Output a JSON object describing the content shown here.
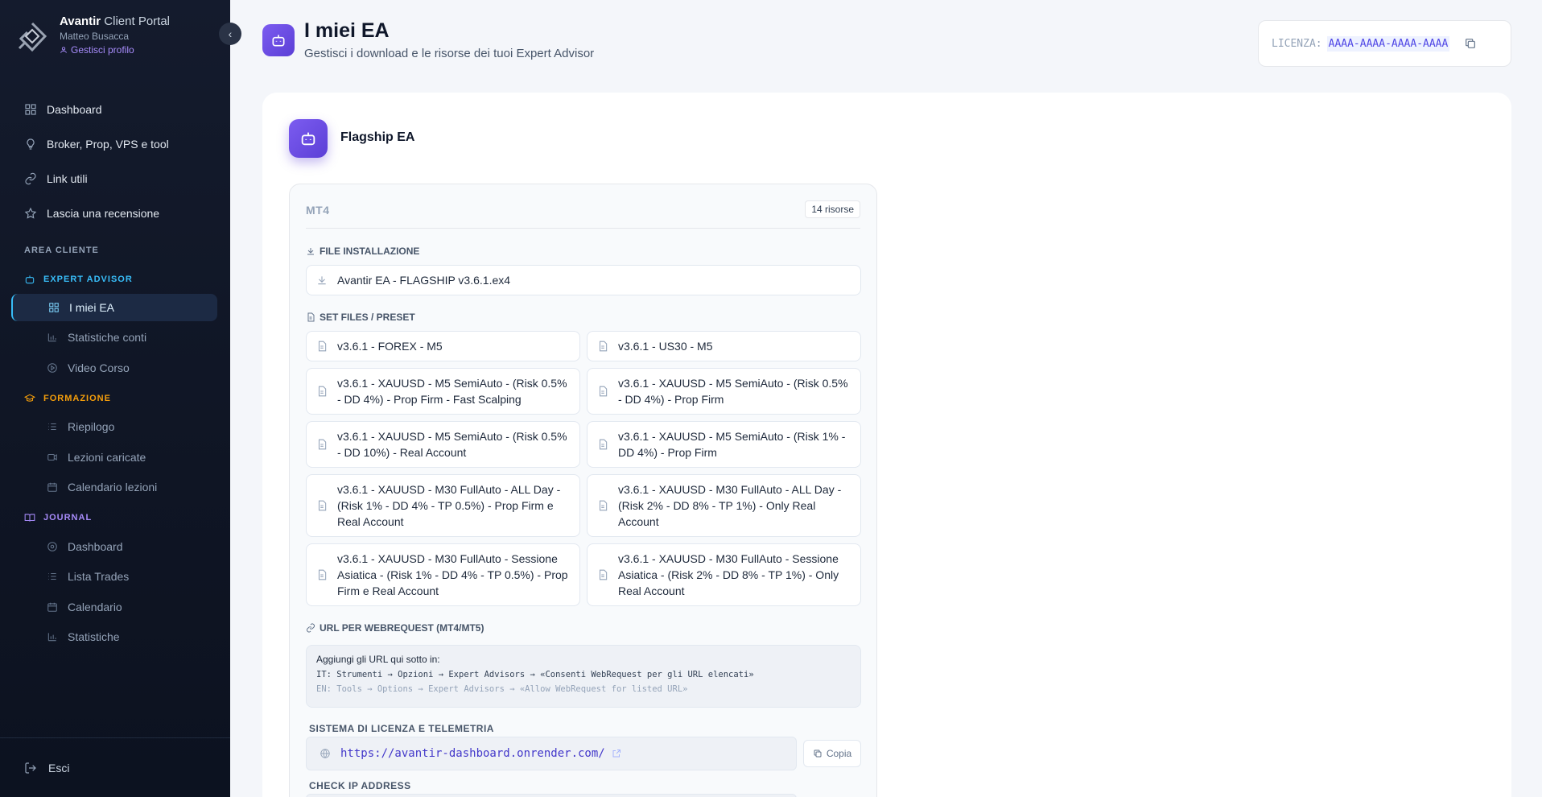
{
  "brand": {
    "name_bold": "Avantir",
    "name_light": "Client Portal",
    "user": "Matteo Busacca",
    "profile_link": "Gestisci profilo"
  },
  "nav": {
    "items": [
      {
        "label": "Dashboard",
        "icon": "grid-icon"
      },
      {
        "label": "Broker, Prop, VPS e tool",
        "icon": "lightbulb-icon"
      },
      {
        "label": "Link utili",
        "icon": "link-icon"
      },
      {
        "label": "Lascia una recensione",
        "icon": "star-icon"
      }
    ]
  },
  "area_cliente": "AREA CLIENTE",
  "groups": {
    "expert_advisor": {
      "label": "EXPERT ADVISOR",
      "color": "#38bdf8",
      "items": [
        "I miei EA",
        "Statistiche conti",
        "Video Corso"
      ]
    },
    "formazione": {
      "label": "FORMAZIONE",
      "color": "#f59e0b",
      "items": [
        "Riepilogo",
        "Lezioni caricate",
        "Calendario lezioni"
      ]
    },
    "journal": {
      "label": "JOURNAL",
      "color": "#a78bfa",
      "items": [
        "Dashboard",
        "Lista Trades",
        "Calendario",
        "Statistiche"
      ]
    }
  },
  "footer": {
    "logout": "Esci"
  },
  "header": {
    "title": "I miei EA",
    "subtitle": "Gestisci i download e le risorse dei tuoi Expert Advisor"
  },
  "license": {
    "label": "LICENZA:",
    "key": "AAAA-AAAA-AAAA-AAAA"
  },
  "ea": {
    "name": "Flagship EA",
    "platform": "MT4",
    "resources_badge": "14 risorse",
    "install_section": "FILE INSTALLAZIONE",
    "install_file": "Avantir EA - FLAGSHIP v3.6.1.ex4",
    "set_section": "SET FILES / PRESET",
    "set_files": [
      "v3.6.1 - FOREX - M5",
      "v3.6.1 - US30 - M5",
      "v3.6.1 - XAUUSD - M5 SemiAuto - (Risk 0.5% - DD 4%) - Prop Firm - Fast Scalping",
      "v3.6.1 - XAUUSD - M5 SemiAuto - (Risk 0.5% - DD 4%) - Prop Firm",
      "v3.6.1 - XAUUSD - M5 SemiAuto - (Risk 0.5% - DD 10%) - Real Account",
      "v3.6.1 - XAUUSD - M5 SemiAuto - (Risk 1% - DD 4%) - Prop Firm",
      "v3.6.1 - XAUUSD - M30 FullAuto - ALL Day - (Risk 1% - DD 4% - TP 0.5%) - Prop Firm e Real Account",
      "v3.6.1 - XAUUSD - M30 FullAuto - ALL Day - (Risk 2% - DD 8% - TP 1%) - Only Real Account",
      "v3.6.1 - XAUUSD - M30 FullAuto - Sessione Asiatica - (Risk 1% - DD 4% - TP 0.5%) - Prop Firm e Real Account",
      "v3.6.1 - XAUUSD - M30 FullAuto - Sessione Asiatica - (Risk 2% - DD 8% - TP 1%) - Only Real Account"
    ],
    "url_section": "URL PER WEBREQUEST (MT4/MT5)",
    "info_title": "Aggiungi gli URL qui sotto in:",
    "info_it": "IT: Strumenti → Opzioni → Expert Advisors → «Consenti WebRequest per gli URL elencati»",
    "info_en": "EN: Tools → Options → Expert Advisors → «Allow WebRequest for listed URL»",
    "urls": [
      {
        "label": "SISTEMA DI LICENZA E TELEMETRIA",
        "url": "https://avantir-dashboard.onrender.com/",
        "copy": "Copia"
      },
      {
        "label": "CHECK IP ADDRESS"
      }
    ]
  }
}
